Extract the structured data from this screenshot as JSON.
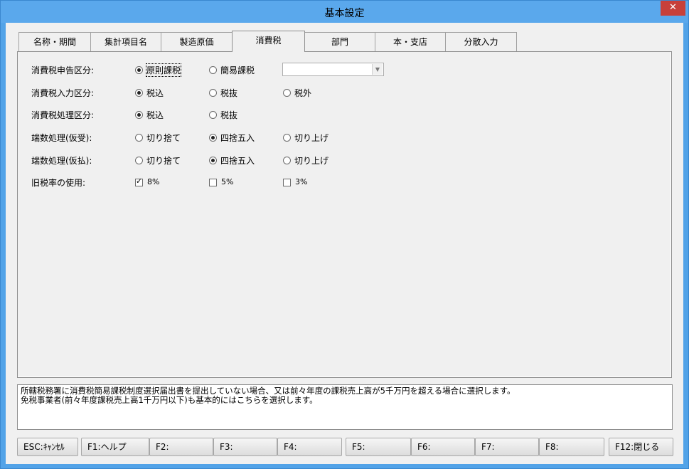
{
  "window": {
    "title": "基本設定",
    "close": "✕"
  },
  "tabs": [
    "名称・期間",
    "集計項目名",
    "製造原価",
    "消費税",
    "部門",
    "本・支店",
    "分散入力"
  ],
  "rows": {
    "r1": {
      "label": "消費税申告区分:",
      "opts": [
        "原則課税",
        "簡易課税"
      ]
    },
    "r2": {
      "label": "消費税入力区分:",
      "opts": [
        "税込",
        "税抜",
        "税外"
      ]
    },
    "r3": {
      "label": "消費税処理区分:",
      "opts": [
        "税込",
        "税抜"
      ]
    },
    "r4": {
      "label": "端数処理(仮受):",
      "opts": [
        "切り捨て",
        "四捨五入",
        "切り上げ"
      ]
    },
    "r5": {
      "label": "端数処理(仮払):",
      "opts": [
        "切り捨て",
        "四捨五入",
        "切り上げ"
      ]
    },
    "r6": {
      "label": "旧税率の使用:",
      "opts": [
        "8%",
        "5%",
        "3%"
      ]
    }
  },
  "select": {
    "value": ""
  },
  "help": {
    "line1": "所轄税務署に消費税簡易課税制度選択届出書を提出していない場合、又は前々年度の課税売上高が5千万円を超える場合に選択します。",
    "line2": "免税事業者(前々年度課税売上高1千万円以下)も基本的にはこちらを選択します。"
  },
  "fkeys": [
    "ESC:ｷｬﾝｾﾙ",
    "F1:ヘルプ",
    "F2:",
    "F3:",
    "F4:",
    "F5:",
    "F6:",
    "F7:",
    "F8:",
    "F12:閉じる"
  ]
}
